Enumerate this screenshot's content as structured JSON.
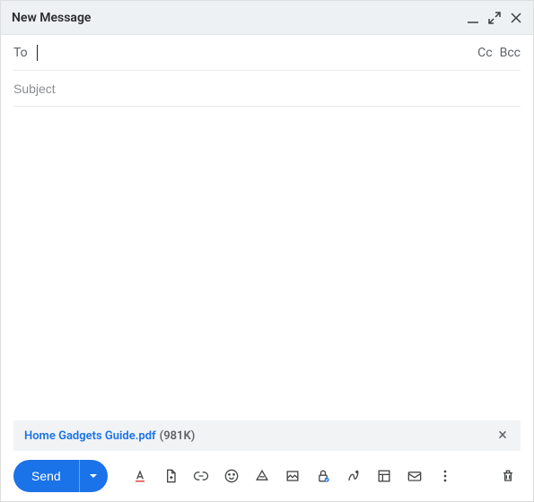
{
  "header": {
    "title": "New Message"
  },
  "fields": {
    "to_label": "To",
    "cc": "Cc",
    "bcc": "Bcc",
    "subject_placeholder": "Subject"
  },
  "attachment": {
    "name": "Home Gadgets Guide.pdf",
    "size": "(981K)"
  },
  "toolbar": {
    "send": "Send"
  }
}
